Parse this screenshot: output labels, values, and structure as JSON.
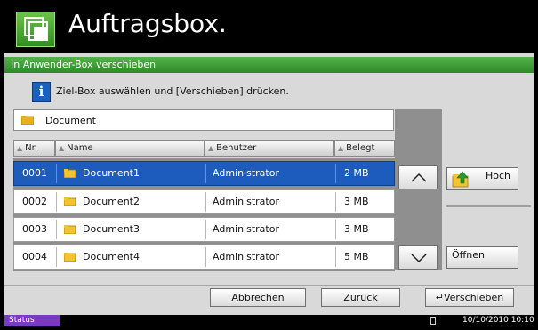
{
  "header": {
    "title": "Auftragsbox."
  },
  "dialog": {
    "title": "In Anwender-Box verschieben",
    "info": "Ziel-Box auswählen und [Verschieben] drücken.",
    "current_folder": "Document"
  },
  "table": {
    "columns": [
      "Nr.",
      "Name",
      "Benutzer",
      "Belegt"
    ],
    "rows": [
      {
        "nr": "0001",
        "name": "Document1",
        "user": "Administrator",
        "used": "2  MB",
        "selected": true
      },
      {
        "nr": "0002",
        "name": "Document2",
        "user": "Administrator",
        "used": "3  MB",
        "selected": false
      },
      {
        "nr": "0003",
        "name": "Document3",
        "user": "Administrator",
        "used": "3  MB",
        "selected": false
      },
      {
        "nr": "0004",
        "name": "Document4",
        "user": "Administrator",
        "used": "5  MB",
        "selected": false
      }
    ]
  },
  "side_buttons": {
    "up": "Hoch",
    "open": "Öffnen"
  },
  "footer_buttons": {
    "cancel": "Abbrechen",
    "back": "Zurück",
    "move": "Verschieben"
  },
  "statusbar": {
    "status": "Status",
    "datetime": "10/10/2010  10:10"
  },
  "colors": {
    "selected_row": "#1d5cbc",
    "title_bar": "#2e8a27",
    "status_tab": "#7a3bbf"
  }
}
